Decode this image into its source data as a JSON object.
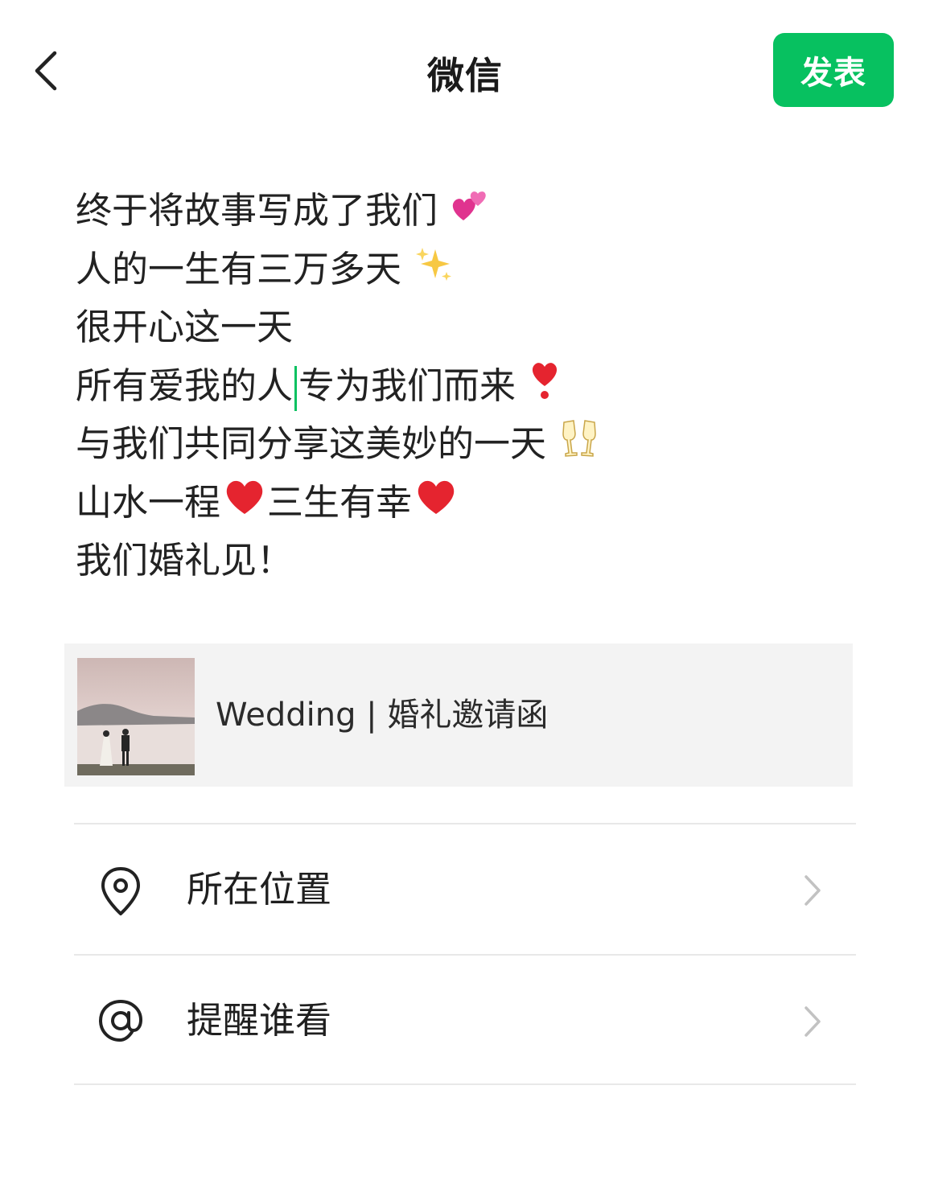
{
  "header": {
    "title": "微信",
    "publish_label": "发表",
    "back_icon": "back-arrow-icon"
  },
  "post": {
    "lines": [
      {
        "text": "终于将故事写成了我们",
        "emoji": "two-hearts"
      },
      {
        "text": "人的一生有三万多天",
        "emoji": "sparkles"
      },
      {
        "text": "很开心这一天",
        "emoji": ""
      },
      {
        "text_before_caret": "所有爱我的人",
        "text_after_caret": "专为我们而来",
        "emoji": "heavy-heart-exclamation"
      },
      {
        "text": "与我们共同分享这美妙的一天",
        "emoji": "clinking-glasses"
      },
      {
        "segments": [
          "山水一程",
          "三生有幸"
        ],
        "emoji": "red-heart"
      },
      {
        "text": "我们婚礼见！",
        "emoji": ""
      }
    ]
  },
  "link_card": {
    "title": "Wedding | 婚礼邀请函",
    "thumbnail": "wedding-couple-photo"
  },
  "options": [
    {
      "label": "所在位置",
      "icon": "location-pin-icon"
    },
    {
      "label": "提醒谁看",
      "icon": "at-sign-icon"
    }
  ],
  "colors": {
    "accent": "#07c160",
    "card_bg": "#f3f3f3",
    "divider": "#e8e8e8"
  }
}
